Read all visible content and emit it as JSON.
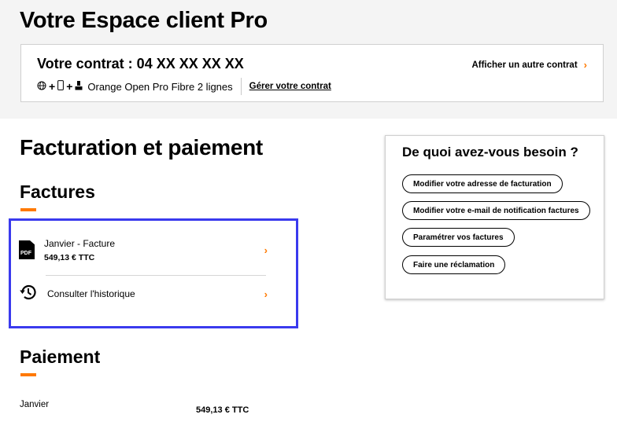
{
  "header": {
    "title": "Votre Espace client Pro"
  },
  "contract": {
    "title": "Votre contrat : 04 XX XX XX XX",
    "offer": "Orange Open Pro Fibre 2 lignes",
    "manage_link": "Gérer votre contrat",
    "other_contract_link": "Afficher un autre contrat",
    "icons": [
      "globe-icon",
      "plus",
      "mobile-icon",
      "plus",
      "landline-phone-icon"
    ]
  },
  "billing": {
    "section_title": "Facturation et paiement",
    "invoices": {
      "title": "Factures",
      "latest": {
        "label": "Janvier - Facture",
        "amount": "549,13 € TTC",
        "icon": "pdf-file-icon",
        "icon_text": "PDF"
      },
      "history": {
        "label": "Consulter l'historique",
        "icon": "history-icon"
      }
    },
    "payment": {
      "title": "Paiement",
      "month": "Janvier",
      "amount": "549,13 € TTC"
    }
  },
  "needs": {
    "title": "De quoi avez-vous besoin ?",
    "actions": [
      {
        "label": "Modifier votre adresse de facturation"
      },
      {
        "label": "Modifier votre e-mail de notification factures"
      },
      {
        "label": "Paramétrer vos factures"
      },
      {
        "label": "Faire une réclamation"
      }
    ]
  },
  "colors": {
    "accent": "#ff7900",
    "highlight": "#3a3aee",
    "band": "#f4f4f4"
  }
}
